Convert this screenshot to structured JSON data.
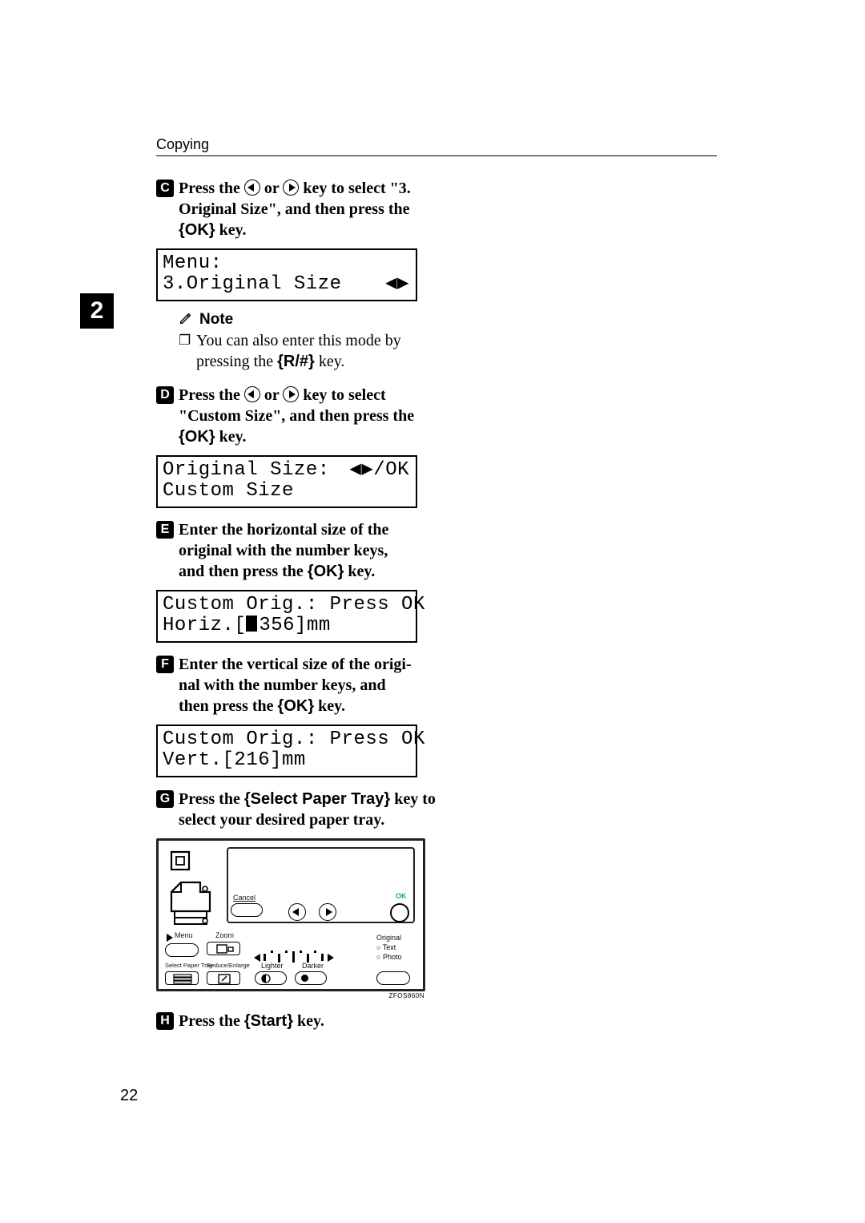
{
  "header": {
    "running_head": "Copying",
    "page_number": "22",
    "chapter_tab": "2"
  },
  "steps": {
    "s3": {
      "num": "C",
      "text_lead": "Press the ",
      "text_mid": " or ",
      "text_tail1": " key to select \"3.",
      "text_tail2": "Original Size\", and then press the",
      "key_label": "OK",
      "text_tail3": " key."
    },
    "s4": {
      "num": "D",
      "text_lead": "Press the ",
      "text_mid": " or ",
      "text_tail1": " key to select",
      "text_tail2": "\"Custom Size\", and then press the",
      "key_label": "OK",
      "text_tail3": " key."
    },
    "s5": {
      "num": "E",
      "line1": "Enter the horizontal size of the",
      "line2": "original with the number keys,",
      "line3_lead": "and then press the ",
      "key_label": "OK",
      "line3_tail": " key."
    },
    "s6": {
      "num": "F",
      "line1": "Enter the vertical size of the origi-",
      "line2": "nal with the number keys, and",
      "line3_lead": "then press the ",
      "key_label": "OK",
      "line3_tail": " key."
    },
    "s7": {
      "num": "G",
      "line1_lead": "Press the ",
      "key_label": "Select Paper Tray",
      "line1_tail": " key to",
      "line2": "select your desired paper tray."
    },
    "s8": {
      "num": "H",
      "line_lead": "Press the ",
      "key_label": "Start",
      "line_tail": " key."
    }
  },
  "lcds": {
    "menu": {
      "l1": "Menu:",
      "l2a": " 3.Original Size",
      "l2_right": "◀▶"
    },
    "orig": {
      "l1a": "Original Size:",
      "l1_right": "◀▶/OK",
      "l2": " Custom Size"
    },
    "horiz": {
      "l1": "Custom Orig.: Press OK",
      "l2a": "Horiz.[",
      "l2b": "356]mm"
    },
    "vert": {
      "l1": "Custom Orig.: Press OK",
      "l2": "Vert.[216]mm"
    }
  },
  "note": {
    "heading": "Note",
    "body_a": "You can also enter this mode by",
    "body_b_lead": "pressing the ",
    "key_label": "R/#",
    "body_b_tail": " key."
  },
  "panel": {
    "cancel": "Cancel",
    "ok": "OK",
    "menu": "Menu",
    "zoom": "Zoom",
    "select_paper_tray": "Select Paper Tray",
    "reduce_enlarge": "Reduce/Enlarge",
    "lighter": "Lighter",
    "darker": "Darker",
    "original": "Original",
    "text": "Text",
    "photo": "Photo",
    "figure_code": "ZFOS860N"
  }
}
